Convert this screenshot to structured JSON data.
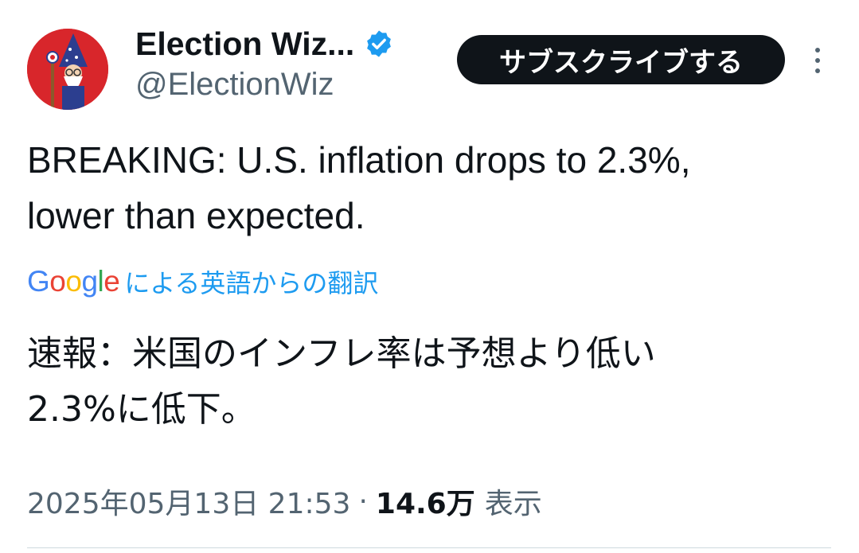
{
  "account": {
    "display_name": "Election Wiz...",
    "handle": "@ElectionWiz",
    "verified": true,
    "avatar_icon": "wizard-avatar-icon"
  },
  "actions": {
    "subscribe_label": "サブスクライブする",
    "more_icon": "more-vertical-icon"
  },
  "tweet": {
    "text_line1": "BREAKING: U.S. inflation drops to 2.3%,",
    "text_line2": "lower than expected."
  },
  "translation": {
    "provider_logo": "Google",
    "label": "による英語からの翻訳",
    "text_line1": "速報：米国のインフレ率は予想より低い",
    "text_line2": "2.3%に低下。"
  },
  "meta": {
    "timestamp": "2025年05月13日 21:53",
    "separator": "·",
    "views_count": "14.6万",
    "views_label": "表示"
  },
  "colors": {
    "text_primary": "#0f1419",
    "text_secondary": "#536471",
    "accent_blue": "#1d9bf0",
    "button_bg": "#0f1419",
    "avatar_bg": "#d8262b"
  }
}
